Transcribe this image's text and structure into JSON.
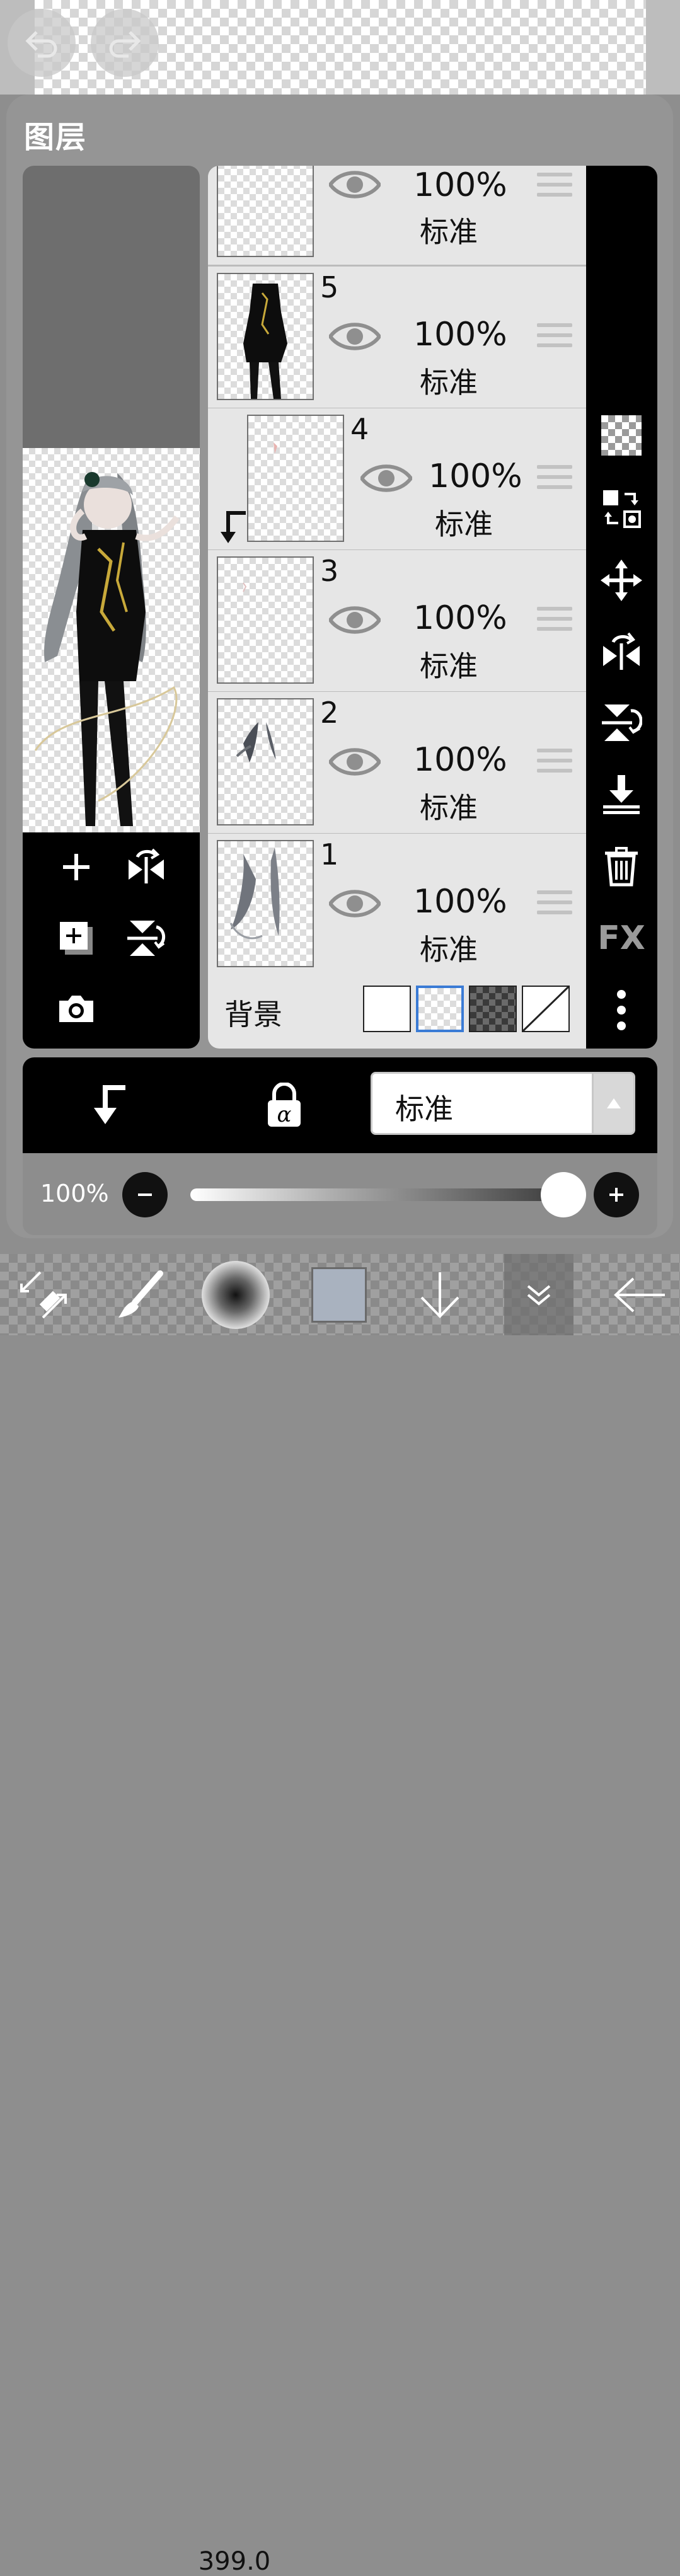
{
  "panel": {
    "title": "图层"
  },
  "layers": [
    {
      "number": "",
      "opacity": "100%",
      "blend": "标准",
      "visible": true
    },
    {
      "number": "5",
      "opacity": "100%",
      "blend": "标准",
      "visible": true
    },
    {
      "number": "4",
      "opacity": "100%",
      "blend": "标准",
      "visible": true,
      "clipped": true
    },
    {
      "number": "3",
      "opacity": "100%",
      "blend": "标准",
      "visible": true
    },
    {
      "number": "2",
      "opacity": "100%",
      "blend": "标准",
      "visible": true
    },
    {
      "number": "1",
      "opacity": "100%",
      "blend": "标准",
      "visible": true
    }
  ],
  "background": {
    "label": "背景",
    "selected": "transparent"
  },
  "right_tools": {
    "icons": [
      "checker-icon",
      "transform-layer-icon",
      "move-icon",
      "flip-horizontal-icon",
      "flip-vertical-icon",
      "merge-down-icon",
      "trash-icon",
      "fx-icon",
      "more-icon"
    ],
    "fx_label": "FX"
  },
  "left_tools": {
    "icons": [
      "add-layer-icon",
      "flip-horizontal-icon",
      "duplicate-layer-icon",
      "flip-vertical-icon",
      "camera-icon"
    ]
  },
  "blend_bar": {
    "mode": "标准"
  },
  "opacity_control": {
    "label": "100%",
    "value": 1.0
  },
  "bottom_toolbar": {
    "brush_size": "399.0",
    "icons": [
      "transform-tool-icon",
      "brush-icon",
      "brush-size-icon",
      "color-swatch-icon",
      "arrow-down-icon",
      "chevron-down-icon",
      "back-arrow-icon"
    ],
    "current_color": "#a9b2bf"
  },
  "colors": {
    "accent_selection": "#3a7bd5",
    "panel_bg": "#969696",
    "toolbar_black": "#000000"
  }
}
